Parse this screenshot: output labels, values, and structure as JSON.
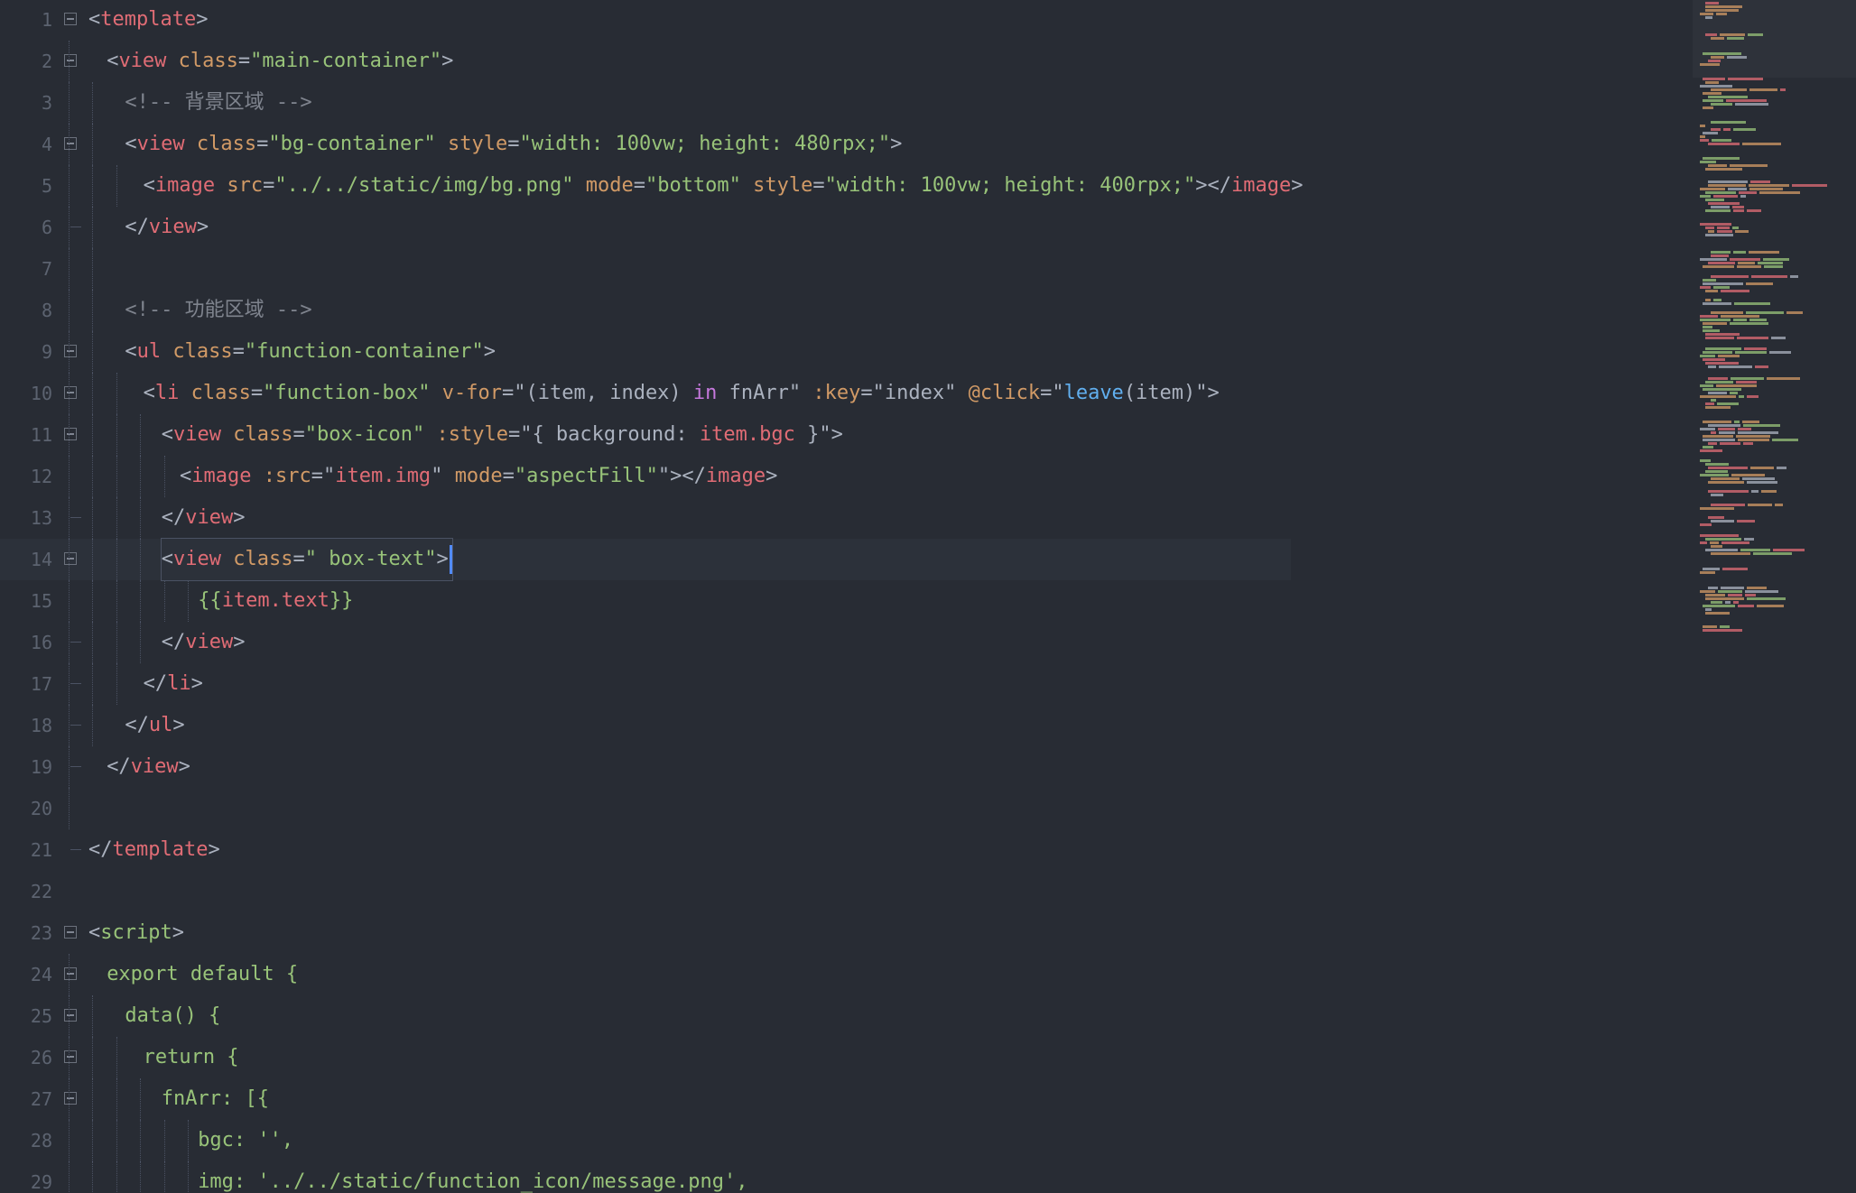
{
  "editor": {
    "current_line": 14,
    "lines": [
      {
        "n": "1",
        "fold": true,
        "indent": 0,
        "tokens": [
          {
            "t": "<",
            "c": "punct"
          },
          {
            "t": "template",
            "c": "tag"
          },
          {
            "t": ">",
            "c": "punct"
          }
        ]
      },
      {
        "n": "2",
        "fold": true,
        "indent": 1,
        "tokens": [
          {
            "t": "<",
            "c": "punct"
          },
          {
            "t": "view",
            "c": "tag"
          },
          {
            "t": " ",
            "c": "plain"
          },
          {
            "t": "class",
            "c": "attr"
          },
          {
            "t": "=",
            "c": "punct"
          },
          {
            "t": "\"main-container\"",
            "c": "str"
          },
          {
            "t": ">",
            "c": "punct"
          }
        ]
      },
      {
        "n": "3",
        "fold": false,
        "indent": 2,
        "tokens": [
          {
            "t": "<!-- 背景区域 -->",
            "c": "com"
          }
        ]
      },
      {
        "n": "4",
        "fold": true,
        "indent": 2,
        "tokens": [
          {
            "t": "<",
            "c": "punct"
          },
          {
            "t": "view",
            "c": "tag"
          },
          {
            "t": " ",
            "c": "plain"
          },
          {
            "t": "class",
            "c": "attr"
          },
          {
            "t": "=",
            "c": "punct"
          },
          {
            "t": "\"bg-container\"",
            "c": "str"
          },
          {
            "t": " ",
            "c": "plain"
          },
          {
            "t": "style",
            "c": "attr"
          },
          {
            "t": "=",
            "c": "punct"
          },
          {
            "t": "\"width: 100vw; height: 480rpx;\"",
            "c": "str"
          },
          {
            "t": ">",
            "c": "punct"
          }
        ]
      },
      {
        "n": "5",
        "fold": false,
        "indent": 3,
        "tokens": [
          {
            "t": "<",
            "c": "punct"
          },
          {
            "t": "image",
            "c": "tag"
          },
          {
            "t": " ",
            "c": "plain"
          },
          {
            "t": "src",
            "c": "attr"
          },
          {
            "t": "=",
            "c": "punct"
          },
          {
            "t": "\"../../static/img/bg.png\"",
            "c": "str"
          },
          {
            "t": " ",
            "c": "plain"
          },
          {
            "t": "mode",
            "c": "attr"
          },
          {
            "t": "=",
            "c": "punct"
          },
          {
            "t": "\"bottom\"",
            "c": "str"
          },
          {
            "t": " ",
            "c": "plain"
          },
          {
            "t": "style",
            "c": "attr"
          },
          {
            "t": "=",
            "c": "punct"
          },
          {
            "t": "\"width: 100vw; height: 400rpx;\"",
            "c": "str"
          },
          {
            "t": "></",
            "c": "punct"
          },
          {
            "t": "image",
            "c": "tag"
          },
          {
            "t": ">",
            "c": "punct"
          }
        ]
      },
      {
        "n": "6",
        "fold": false,
        "indent": 2,
        "end": true,
        "tokens": [
          {
            "t": "</",
            "c": "punct"
          },
          {
            "t": "view",
            "c": "tag"
          },
          {
            "t": ">",
            "c": "punct"
          }
        ]
      },
      {
        "n": "7",
        "fold": false,
        "indent": 2,
        "tokens": []
      },
      {
        "n": "8",
        "fold": false,
        "indent": 2,
        "tokens": [
          {
            "t": "<!-- 功能区域 -->",
            "c": "com"
          }
        ]
      },
      {
        "n": "9",
        "fold": true,
        "indent": 2,
        "tokens": [
          {
            "t": "<",
            "c": "punct"
          },
          {
            "t": "ul",
            "c": "tag"
          },
          {
            "t": " ",
            "c": "plain"
          },
          {
            "t": "class",
            "c": "attr"
          },
          {
            "t": "=",
            "c": "punct"
          },
          {
            "t": "\"function-container\"",
            "c": "str"
          },
          {
            "t": ">",
            "c": "punct"
          }
        ]
      },
      {
        "n": "10",
        "fold": true,
        "indent": 3,
        "tokens": [
          {
            "t": "<",
            "c": "punct"
          },
          {
            "t": "li",
            "c": "tag"
          },
          {
            "t": " ",
            "c": "plain"
          },
          {
            "t": "class",
            "c": "attr"
          },
          {
            "t": "=",
            "c": "punct"
          },
          {
            "t": "\"function-box\"",
            "c": "str"
          },
          {
            "t": " ",
            "c": "plain"
          },
          {
            "t": "v-for",
            "c": "attr"
          },
          {
            "t": "=\"(item, index) ",
            "c": "plain"
          },
          {
            "t": "in",
            "c": "kw"
          },
          {
            "t": " fnArr\" ",
            "c": "plain"
          },
          {
            "t": ":key",
            "c": "attr"
          },
          {
            "t": "=\"index\" ",
            "c": "plain"
          },
          {
            "t": "@click",
            "c": "attr"
          },
          {
            "t": "=\"",
            "c": "plain"
          },
          {
            "t": "leave",
            "c": "fn"
          },
          {
            "t": "(item)\">",
            "c": "plain"
          }
        ]
      },
      {
        "n": "11",
        "fold": true,
        "indent": 4,
        "tokens": [
          {
            "t": "<",
            "c": "punct"
          },
          {
            "t": "view",
            "c": "tag"
          },
          {
            "t": " ",
            "c": "plain"
          },
          {
            "t": "class",
            "c": "attr"
          },
          {
            "t": "=",
            "c": "punct"
          },
          {
            "t": "\"box-icon\"",
            "c": "str"
          },
          {
            "t": " ",
            "c": "plain"
          },
          {
            "t": ":style",
            "c": "attr"
          },
          {
            "t": "=\"{ background: ",
            "c": "plain"
          },
          {
            "t": "item.bgc",
            "c": "var"
          },
          {
            "t": " }\">",
            "c": "plain"
          }
        ]
      },
      {
        "n": "12",
        "fold": false,
        "indent": 5,
        "tokens": [
          {
            "t": "<",
            "c": "punct"
          },
          {
            "t": "image",
            "c": "tag"
          },
          {
            "t": " ",
            "c": "plain"
          },
          {
            "t": ":src",
            "c": "attr"
          },
          {
            "t": "=\"",
            "c": "plain"
          },
          {
            "t": "item.img",
            "c": "var"
          },
          {
            "t": "\" ",
            "c": "plain"
          },
          {
            "t": "mode",
            "c": "attr"
          },
          {
            "t": "=",
            "c": "punct"
          },
          {
            "t": "\"aspectFill\"",
            "c": "str"
          },
          {
            "t": "\"></",
            "c": "punct"
          },
          {
            "t": "image",
            "c": "tag"
          },
          {
            "t": ">",
            "c": "punct"
          }
        ]
      },
      {
        "n": "13",
        "fold": false,
        "indent": 4,
        "end": true,
        "tokens": [
          {
            "t": "</",
            "c": "punct"
          },
          {
            "t": "view",
            "c": "tag"
          },
          {
            "t": ">",
            "c": "punct"
          }
        ]
      },
      {
        "n": "14",
        "fold": true,
        "indent": 4,
        "tokens": [
          {
            "t": "<",
            "c": "punct"
          },
          {
            "t": "view",
            "c": "tag"
          },
          {
            "t": " ",
            "c": "plain"
          },
          {
            "t": "class",
            "c": "attr"
          },
          {
            "t": "=",
            "c": "punct"
          },
          {
            "t": "\" box-text\"",
            "c": "str"
          },
          {
            "t": ">",
            "c": "punct"
          }
        ]
      },
      {
        "n": "15",
        "fold": false,
        "indent": 6,
        "tokens": [
          {
            "t": "{{",
            "c": "grn"
          },
          {
            "t": "item.text",
            "c": "var"
          },
          {
            "t": "}}",
            "c": "grn"
          }
        ]
      },
      {
        "n": "16",
        "fold": false,
        "indent": 4,
        "end": true,
        "tokens": [
          {
            "t": "</",
            "c": "punct"
          },
          {
            "t": "view",
            "c": "tag"
          },
          {
            "t": ">",
            "c": "punct"
          }
        ]
      },
      {
        "n": "17",
        "fold": false,
        "indent": 3,
        "end": true,
        "tokens": [
          {
            "t": "</",
            "c": "punct"
          },
          {
            "t": "li",
            "c": "tag"
          },
          {
            "t": ">",
            "c": "punct"
          }
        ]
      },
      {
        "n": "18",
        "fold": false,
        "indent": 2,
        "end": true,
        "tokens": [
          {
            "t": "</",
            "c": "punct"
          },
          {
            "t": "ul",
            "c": "tag"
          },
          {
            "t": ">",
            "c": "punct"
          }
        ]
      },
      {
        "n": "19",
        "fold": false,
        "indent": 1,
        "end": true,
        "tokens": [
          {
            "t": "</",
            "c": "punct"
          },
          {
            "t": "view",
            "c": "tag"
          },
          {
            "t": ">",
            "c": "punct"
          }
        ]
      },
      {
        "n": "20",
        "fold": false,
        "indent": 1,
        "tokens": []
      },
      {
        "n": "21",
        "fold": false,
        "indent": 0,
        "end": true,
        "tokens": [
          {
            "t": "</",
            "c": "punct"
          },
          {
            "t": "template",
            "c": "tag"
          },
          {
            "t": ">",
            "c": "punct"
          }
        ]
      },
      {
        "n": "22",
        "fold": false,
        "indent": 0,
        "tokens": []
      },
      {
        "n": "23",
        "fold": true,
        "indent": 0,
        "tokens": [
          {
            "t": "<",
            "c": "punct"
          },
          {
            "t": "script",
            "c": "grn"
          },
          {
            "t": ">",
            "c": "punct"
          }
        ]
      },
      {
        "n": "24",
        "fold": true,
        "indent": 1,
        "tokens": [
          {
            "t": "export default {",
            "c": "grn"
          }
        ]
      },
      {
        "n": "25",
        "fold": true,
        "indent": 2,
        "tokens": [
          {
            "t": "data() {",
            "c": "grn"
          }
        ]
      },
      {
        "n": "26",
        "fold": true,
        "indent": 3,
        "tokens": [
          {
            "t": "return {",
            "c": "grn"
          }
        ]
      },
      {
        "n": "27",
        "fold": true,
        "indent": 4,
        "tokens": [
          {
            "t": "fnArr: [{",
            "c": "grn"
          }
        ]
      },
      {
        "n": "28",
        "fold": false,
        "indent": 6,
        "tokens": [
          {
            "t": "bgc: '',",
            "c": "grn"
          }
        ]
      },
      {
        "n": "29",
        "fold": false,
        "indent": 6,
        "tokens": [
          {
            "t": "img: '../../static/function_icon/message.png',",
            "c": "grn"
          }
        ]
      }
    ]
  },
  "colors": {
    "background": "#282c34",
    "current_line": "#2c313a",
    "cursor": "#528bff",
    "tag": "#e06c75",
    "attribute": "#d19a66",
    "string": "#98c379",
    "comment": "#7f848e",
    "keyword": "#c678dd",
    "function": "#61afef"
  }
}
